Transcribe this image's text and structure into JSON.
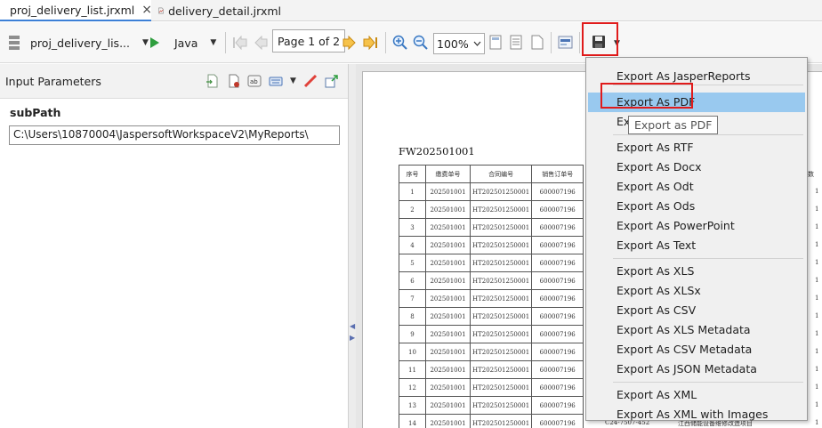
{
  "tabs": [
    {
      "label": "proj_delivery_list.jrxml",
      "active": true,
      "close": "×"
    },
    {
      "label": "delivery_detail.jrxml",
      "active": false
    }
  ],
  "toolbar": {
    "data_adapter": "proj_delivery_lis...",
    "language": "Java",
    "page_label": "Page 1 of 2",
    "zoom": "100%"
  },
  "input_parameters": {
    "title": "Input Parameters",
    "param_label": "subPath",
    "param_value": "C:\\Users\\10870004\\JaspersoftWorkspaceV2\\MyReports\\"
  },
  "report": {
    "title": "FW202501001",
    "headers": [
      "序号",
      "缴费单号",
      "合同编号",
      "销售订单号"
    ],
    "right_header": "数",
    "rows": [
      {
        "n": "1",
        "pay": "202501001",
        "contract": "HT202501250001",
        "order": "600007196"
      },
      {
        "n": "2",
        "pay": "202501001",
        "contract": "HT202501250001",
        "order": "600007196"
      },
      {
        "n": "3",
        "pay": "202501001",
        "contract": "HT202501250001",
        "order": "600007196"
      },
      {
        "n": "4",
        "pay": "202501001",
        "contract": "HT202501250001",
        "order": "600007196"
      },
      {
        "n": "5",
        "pay": "202501001",
        "contract": "HT202501250001",
        "order": "600007196"
      },
      {
        "n": "6",
        "pay": "202501001",
        "contract": "HT202501250001",
        "order": "600007196"
      },
      {
        "n": "7",
        "pay": "202501001",
        "contract": "HT202501250001",
        "order": "600007196"
      },
      {
        "n": "8",
        "pay": "202501001",
        "contract": "HT202501250001",
        "order": "600007196"
      },
      {
        "n": "9",
        "pay": "202501001",
        "contract": "HT202501250001",
        "order": "600007196"
      },
      {
        "n": "10",
        "pay": "202501001",
        "contract": "HT202501250001",
        "order": "600007196"
      },
      {
        "n": "11",
        "pay": "202501001",
        "contract": "HT202501250001",
        "order": "600007196"
      },
      {
        "n": "12",
        "pay": "202501001",
        "contract": "HT202501250001",
        "order": "600007196"
      },
      {
        "n": "13",
        "pay": "202501001",
        "contract": "HT202501250001",
        "order": "600007196"
      },
      {
        "n": "14",
        "pay": "202501001",
        "contract": "HT202501250001",
        "order": "600007196"
      }
    ],
    "right_col_values": [
      "1",
      "1",
      "1",
      "1",
      "1",
      "1",
      "1",
      "1",
      "1",
      "1",
      "1",
      "1",
      "1",
      "1"
    ],
    "last_row_tail": [
      "C24-7507-452",
      "江西储能设备维修改造项目"
    ]
  },
  "export_menu": {
    "items": [
      "Export As JasperReports",
      "Export As PDF",
      "Export As HTML",
      "Export As RTF",
      "Export As Docx",
      "Export As Odt",
      "Export As Ods",
      "Export As PowerPoint",
      "Export As Text",
      "Export As XLS",
      "Export As XLSx",
      "Export As CSV",
      "Export As XLS Metadata",
      "Export As CSV Metadata",
      "Export As JSON Metadata",
      "Export As XML",
      "Export As XML with Images"
    ],
    "tooltip": "Export as PDF",
    "selected_index": 1
  },
  "colors": {
    "highlight": "#99c9ef",
    "red_annotation": "#e01b1b",
    "run_green": "#2e9e3e",
    "nav_orange": "#e8a21a"
  }
}
